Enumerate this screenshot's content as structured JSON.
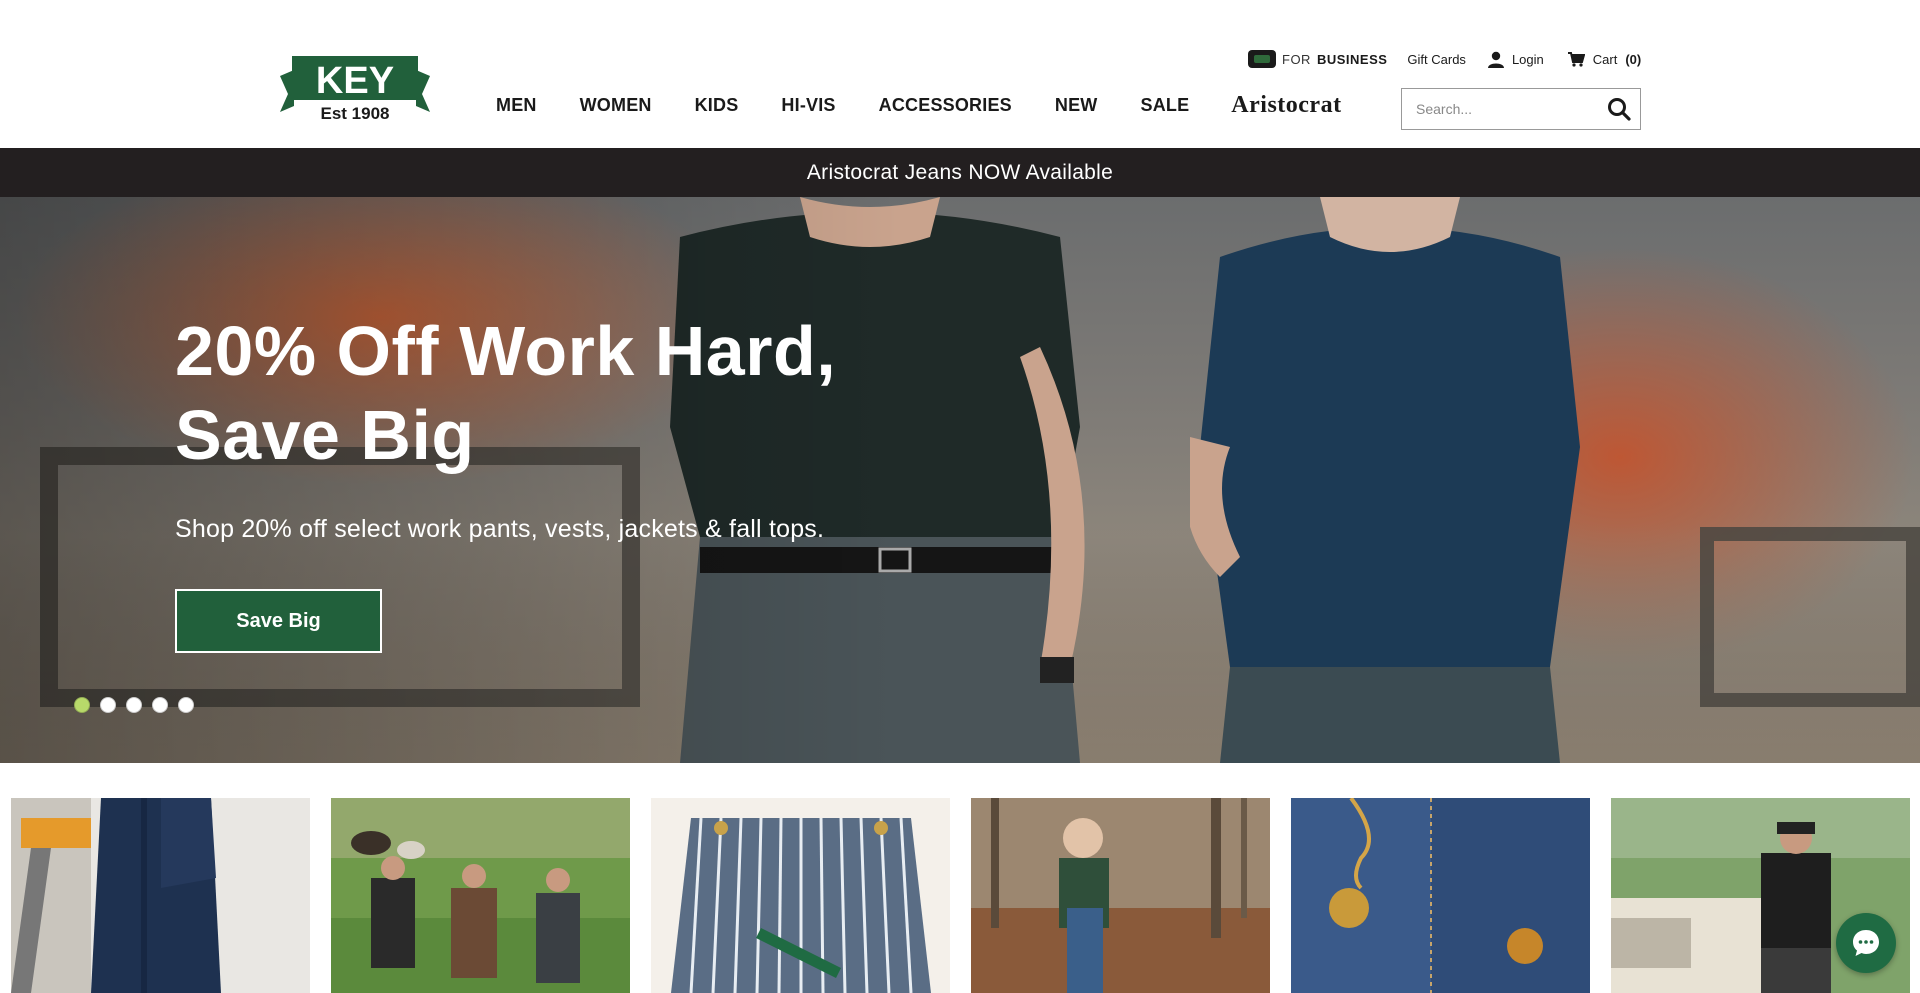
{
  "header": {
    "logo": {
      "brand": "KEY",
      "est": "Est 1908"
    },
    "utility": {
      "for_label": "FOR",
      "business_label": "BUSINESS",
      "gift_cards": "Gift Cards",
      "login": "Login",
      "cart_label": "Cart",
      "cart_count": "(0)"
    },
    "nav": {
      "items": [
        "MEN",
        "WOMEN",
        "KIDS",
        "HI-VIS",
        "ACCESSORIES",
        "NEW",
        "SALE"
      ],
      "aristocrat": "Aristocrat"
    },
    "search": {
      "placeholder": "Search..."
    }
  },
  "promo_bar": {
    "text": "Aristocrat Jeans NOW Available"
  },
  "hero": {
    "headline_line1": "20% Off Work Hard,",
    "headline_line2": "Save Big",
    "subtext": "Shop 20% off select work pants, vests, jackets & fall tops.",
    "cta": "Save Big",
    "slides_total": 5,
    "active_slide": 1
  },
  "colors": {
    "brand_green": "#21603b",
    "promo_bg": "#231f20",
    "active_dot": "#b8d96a",
    "chat_bg": "#1f6b43"
  },
  "tiles": [
    {
      "icon": "jeans-workbench-image"
    },
    {
      "icon": "men-walking-field-image"
    },
    {
      "icon": "striped-overalls-image"
    },
    {
      "icon": "child-in-leaves-image"
    },
    {
      "icon": "denim-key-charm-image"
    },
    {
      "icon": "man-with-truck-image"
    }
  ]
}
